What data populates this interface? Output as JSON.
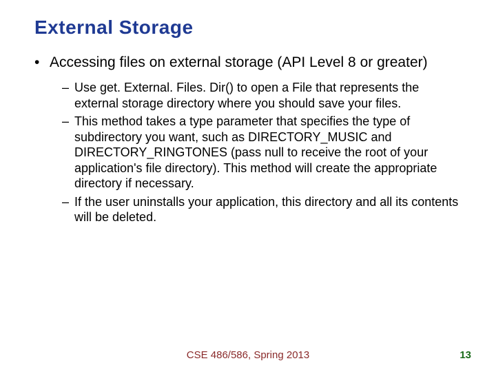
{
  "title": "External Storage",
  "bullet1": "Accessing files on external storage (API Level 8 or greater)",
  "sub1": "Use get. External. Files. Dir() to open a File that represents the external storage directory where you should save your files.",
  "sub2": "This method takes a type parameter that specifies the type of subdirectory you want, such as DIRECTORY_MUSIC and DIRECTORY_RINGTONES (pass null to receive the root of your application's file directory). This method will create the appropriate directory if necessary.",
  "sub3": "If the user uninstalls your application, this directory and all its contents will be deleted.",
  "footer_course": "CSE 486/586, Spring 2013",
  "page_number": "13"
}
